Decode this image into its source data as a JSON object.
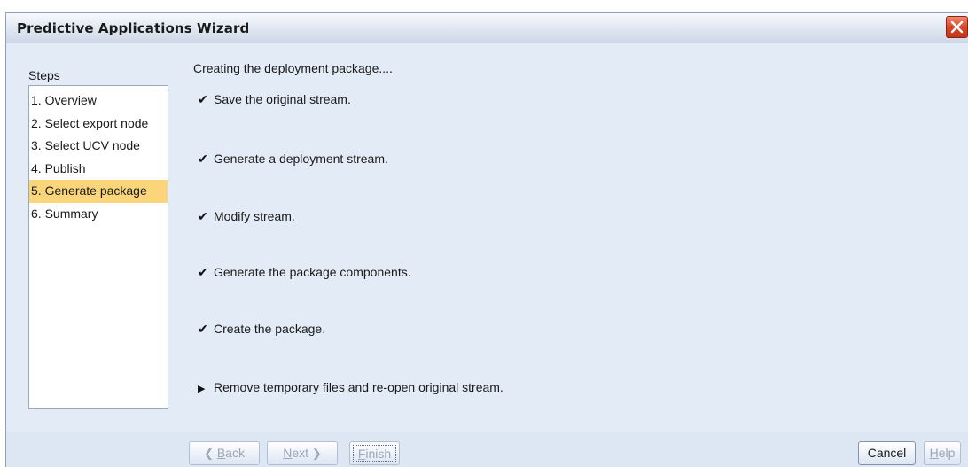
{
  "window": {
    "title": "Predictive Applications Wizard",
    "close_icon": "close-icon"
  },
  "sidebar": {
    "label": "Steps",
    "items": [
      {
        "label": "1. Overview",
        "active": false
      },
      {
        "label": "2. Select export node",
        "active": false
      },
      {
        "label": "3. Select UCV node",
        "active": false
      },
      {
        "label": "4. Publish",
        "active": false
      },
      {
        "label": "5. Generate package",
        "active": true
      },
      {
        "label": "6. Summary",
        "active": false
      }
    ]
  },
  "main": {
    "heading": "Creating the deployment package....",
    "tasks": [
      {
        "label": "Save the original stream.",
        "status": "done",
        "icon": "checkmark-icon"
      },
      {
        "label": "Generate a deployment stream.",
        "status": "done",
        "icon": "checkmark-icon"
      },
      {
        "label": "Modify stream.",
        "status": "done",
        "icon": "checkmark-icon"
      },
      {
        "label": "Generate the package components.",
        "status": "done",
        "icon": "checkmark-icon"
      },
      {
        "label": "Create the package.",
        "status": "done",
        "icon": "checkmark-icon"
      },
      {
        "label": "Remove temporary files and re-open original stream.",
        "status": "in-progress",
        "icon": "play-arrow-icon"
      }
    ]
  },
  "footer": {
    "back": {
      "mnemonic": "B",
      "rest": "ack",
      "enabled": false
    },
    "next": {
      "mnemonic": "N",
      "rest": "ext",
      "enabled": false
    },
    "finish": {
      "mnemonic": "F",
      "rest": "inish",
      "enabled": false
    },
    "cancel": {
      "label": "Cancel",
      "enabled": true
    },
    "help": {
      "mnemonic": "H",
      "rest": "elp",
      "enabled": false
    }
  },
  "colors": {
    "active_step": "#fbd57a",
    "window_bg": "#e3ebf7",
    "close_button": "#d9472b"
  }
}
